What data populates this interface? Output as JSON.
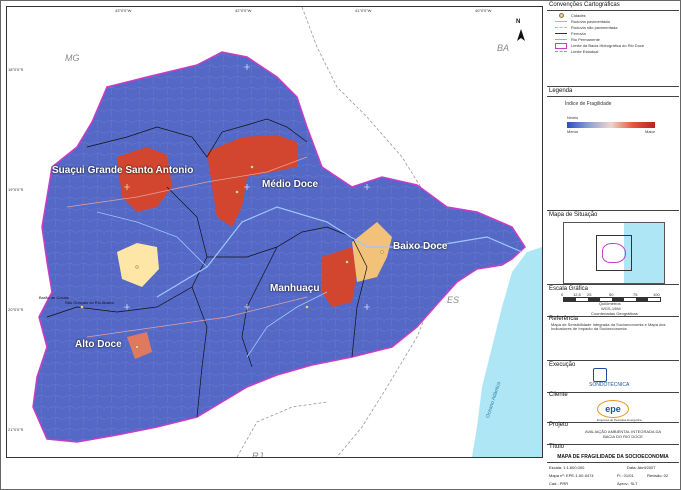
{
  "map": {
    "regions": {
      "suacui": "Suaçui Grande Santo Antonio",
      "medio": "Médio Doce",
      "baixo": "Baixo Doce",
      "manhuacu": "Manhuaçu",
      "alto": "Alto Doce"
    },
    "states": {
      "mg": "MG",
      "ba": "BA",
      "es": "ES",
      "rj": "RJ"
    },
    "ocean": "Oceano Atlântico",
    "top_ticks": [
      "43°0'0\"W",
      "42°0'0\"W",
      "41°0'0\"W",
      "40°0'0\"W"
    ],
    "left_ticks": [
      "18°0'0\"S",
      "19°0'0\"S",
      "20°0'0\"S",
      "21°0'0\"S"
    ],
    "city_labels": [
      "Barão de Cocais",
      "São Gonçalo do Rio Abaixo"
    ],
    "north": "N"
  },
  "panel": {
    "conventions_title": "Convenções Cartográficas",
    "conventions": [
      "Cidades",
      "Rodovia pavimentada",
      "Rodovia não pavimentada",
      "Ferrovia",
      "Rio Permanente",
      "Limite da Bacia Hidrográfica do Rio Doce",
      "Limite Estadual"
    ],
    "legend_title": "Legenda",
    "legend_item": "Índice de Fragilidade",
    "legend_levels_label": "Níveis",
    "legend_min": "Menor",
    "legend_max": "Maior",
    "situation_title": "Mapa de Situação",
    "scale_title": "Escala Gráfica",
    "scale_ticks": [
      "0",
      "12,5",
      "25",
      "50",
      "75",
      "100"
    ],
    "scale_unit": "Quilômetros",
    "datum": "WGS-1984",
    "coords": "Coordenadas Geográficas",
    "reference_title": "Referência",
    "reference_text": "Mapa de Sensibilidade Integrada da Socioeconomia e Mapa dos Indicadores de Impacto da Socioeconomia",
    "execucao_title": "Execução",
    "executor": "SONDOTÉCNICA",
    "cliente_title": "Cliente",
    "client": "epe",
    "client_sub": "Empresa de Pesquisa Energética",
    "projeto_title": "Projeto",
    "project": "AVALIAÇÃO AMBIENTAL INTEGRADA DA BACIA DO RIO DOCE",
    "titulo_title": "Título"
  },
  "footer": {
    "map_title": "MAPA DE FRAGILIDADE DA SOCIOECONOMIA",
    "escala": "Escala: 1:1.600.000",
    "data": "Data: Abril/2007",
    "mapa_no": "Mapa nº: EPE-1-00-0474",
    "folha": "Fl.: 01/01",
    "revisao": "Revisão: 02",
    "cad": "Cad.: PRR",
    "aprov": "Aprov.: SLT"
  },
  "colors": {
    "base_blue": "#5368c4",
    "red": "#d2462f",
    "light_orange": "#f2c27a",
    "yellow": "#fde6a6",
    "border": "#c83cc8",
    "ocean": "#aee6f5"
  }
}
